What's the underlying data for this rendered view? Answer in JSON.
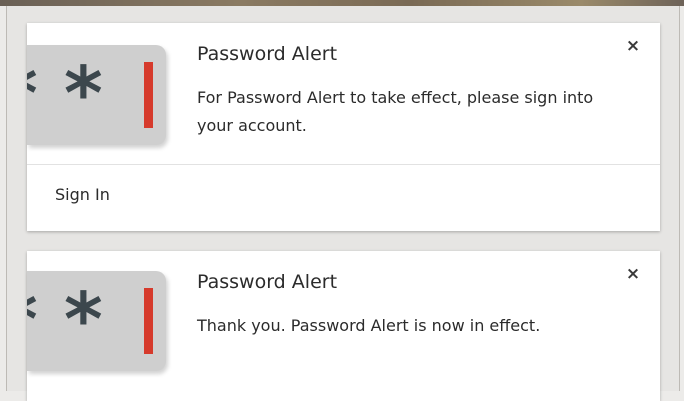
{
  "notifications": [
    {
      "title": "Password Alert",
      "message": "For Password Alert to take effect, please sign into your account.",
      "action_label": "Sign In",
      "close_glyph": "×",
      "icon": "password-alert-logo-icon"
    },
    {
      "title": "Password Alert",
      "message": "Thank you. Password Alert is now in effect.",
      "close_glyph": "×",
      "icon": "password-alert-logo-icon"
    }
  ],
  "logo": {
    "star_glyph": "*",
    "star_color": "#3c474d",
    "bar_color": "#d63a2c",
    "tile_color": "#cfcfcf"
  }
}
